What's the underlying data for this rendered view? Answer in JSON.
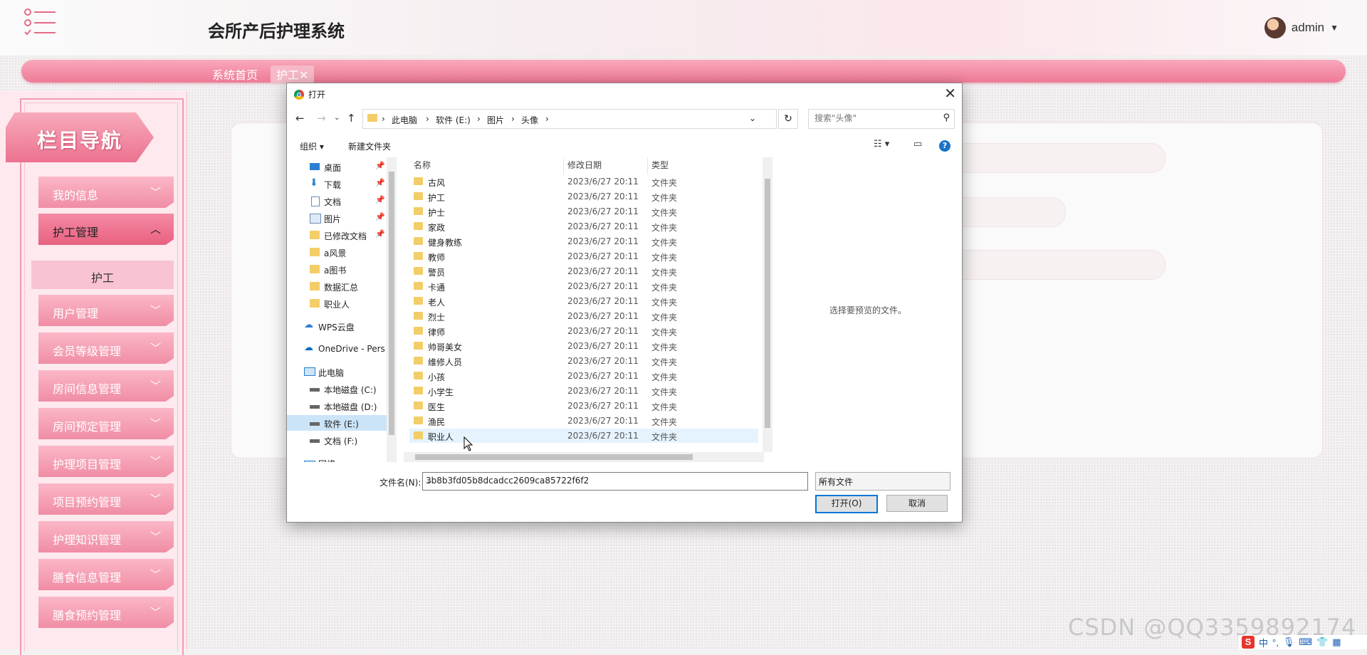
{
  "app": {
    "title": "会所产后护理系统",
    "user": "admin"
  },
  "nav": {
    "home": "系统首页",
    "active_tab": "护工✕"
  },
  "sidebar": {
    "banner": "栏目导航",
    "items": [
      {
        "label": "我的信息",
        "expanded": false
      },
      {
        "label": "护工管理",
        "expanded": true
      },
      {
        "label": "用户管理",
        "expanded": false
      },
      {
        "label": "会员等级管理",
        "expanded": false
      },
      {
        "label": "房间信息管理",
        "expanded": false
      },
      {
        "label": "房间预定管理",
        "expanded": false
      },
      {
        "label": "护理项目管理",
        "expanded": false
      },
      {
        "label": "项目预约管理",
        "expanded": false
      },
      {
        "label": "护理知识管理",
        "expanded": false
      },
      {
        "label": "膳食信息管理",
        "expanded": false
      },
      {
        "label": "膳食预约管理",
        "expanded": false
      }
    ],
    "sub_item": "护工",
    "chevron_down": "﹀",
    "chevron_up": "︿"
  },
  "dialog": {
    "title": "打开",
    "close": "✕",
    "breadcrumb": [
      "此电脑",
      "软件 (E:)",
      "图片",
      "头像"
    ],
    "search_placeholder": "搜索\"头像\"",
    "toolbar": {
      "organize": "组织 ▾",
      "new_folder": "新建文件夹"
    },
    "nav_pane": [
      {
        "label": "桌面",
        "icon": "desktop-icon",
        "pinned": true
      },
      {
        "label": "下载",
        "icon": "download-icon",
        "pinned": true
      },
      {
        "label": "文档",
        "icon": "document-icon",
        "pinned": true
      },
      {
        "label": "图片",
        "icon": "pictures-icon",
        "pinned": true
      },
      {
        "label": "已修改文档",
        "icon": "folder-icon",
        "pinned": true
      },
      {
        "label": "a风景",
        "icon": "folder-icon",
        "pinned": false
      },
      {
        "label": "a图书",
        "icon": "folder-icon",
        "pinned": false
      },
      {
        "label": "数据汇总",
        "icon": "folder-icon",
        "pinned": false
      },
      {
        "label": "职业人",
        "icon": "folder-icon",
        "pinned": false
      },
      {
        "label": "WPS云盘",
        "icon": "cloud-icon",
        "pinned": false
      },
      {
        "label": "OneDrive - Pers",
        "icon": "cloud-icon",
        "pinned": false
      },
      {
        "label": "此电脑",
        "icon": "computer-icon",
        "pinned": false
      },
      {
        "label": "本地磁盘 (C:)",
        "icon": "drive-icon",
        "pinned": false
      },
      {
        "label": "本地磁盘 (D:)",
        "icon": "drive-icon",
        "pinned": false
      },
      {
        "label": "软件 (E:)",
        "icon": "drive-icon",
        "pinned": false,
        "selected": true
      },
      {
        "label": "文档 (F:)",
        "icon": "drive-icon",
        "pinned": false
      },
      {
        "label": "网络",
        "icon": "network-icon",
        "pinned": false
      }
    ],
    "columns": {
      "name": "名称",
      "date": "修改日期",
      "type": "类型"
    },
    "files": [
      {
        "name": "古风",
        "date": "2023/6/27 20:11",
        "type": "文件夹"
      },
      {
        "name": "护工",
        "date": "2023/6/27 20:11",
        "type": "文件夹"
      },
      {
        "name": "护士",
        "date": "2023/6/27 20:11",
        "type": "文件夹"
      },
      {
        "name": "家政",
        "date": "2023/6/27 20:11",
        "type": "文件夹"
      },
      {
        "name": "健身教练",
        "date": "2023/6/27 20:11",
        "type": "文件夹"
      },
      {
        "name": "教师",
        "date": "2023/6/27 20:11",
        "type": "文件夹"
      },
      {
        "name": "警员",
        "date": "2023/6/27 20:11",
        "type": "文件夹"
      },
      {
        "name": "卡通",
        "date": "2023/6/27 20:11",
        "type": "文件夹"
      },
      {
        "name": "老人",
        "date": "2023/6/27 20:11",
        "type": "文件夹"
      },
      {
        "name": "烈士",
        "date": "2023/6/27 20:11",
        "type": "文件夹"
      },
      {
        "name": "律师",
        "date": "2023/6/27 20:11",
        "type": "文件夹"
      },
      {
        "name": "帅哥美女",
        "date": "2023/6/27 20:11",
        "type": "文件夹"
      },
      {
        "name": "维修人员",
        "date": "2023/6/27 20:11",
        "type": "文件夹"
      },
      {
        "name": "小孩",
        "date": "2023/6/27 20:11",
        "type": "文件夹"
      },
      {
        "name": "小学生",
        "date": "2023/6/27 20:11",
        "type": "文件夹"
      },
      {
        "name": "医生",
        "date": "2023/6/27 20:11",
        "type": "文件夹"
      },
      {
        "name": "渔民",
        "date": "2023/6/27 20:11",
        "type": "文件夹"
      },
      {
        "name": "职业人",
        "date": "2023/6/27 20:11",
        "type": "文件夹",
        "hover": true
      }
    ],
    "preview_text": "选择要预览的文件。",
    "filename_label": "文件名(N):",
    "filename_value": "3b8b3fd05b8dcadcc2609ca85722f6f2",
    "filetype": "所有文件",
    "open_button": "打开(O)",
    "cancel_button": "取消"
  },
  "watermark": "CSDN @QQ3359892174",
  "ime": {
    "logo": "S",
    "lang": "中"
  },
  "colors": {
    "accent": "#ee7a96",
    "sidebar_bg": "#fde9ee",
    "dialog_focus": "#0078d7"
  }
}
